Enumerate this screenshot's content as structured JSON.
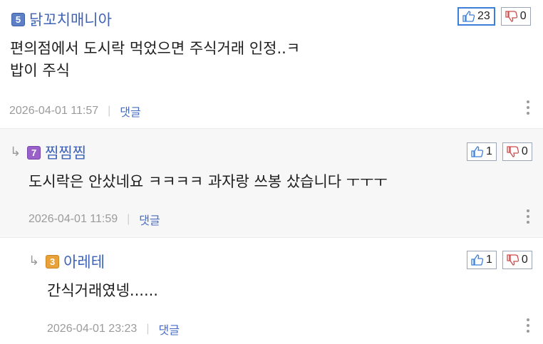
{
  "comments": [
    {
      "level": "5",
      "nickname": "닭꼬치매니아",
      "text": "편의점에서 도시락 먹었으면 주식거래 인정..ㅋ\n밥이 주식",
      "date": "2026-04-01 11:57",
      "reply_label": "댓글",
      "upvotes": "23",
      "downvotes": "0"
    },
    {
      "reply_arrow": "↳",
      "level": "7",
      "nickname": "찜찜찜",
      "text": "도시락은 안샀네요 ㅋㅋㅋㅋ 과자랑 쓰봉 샀습니다 ㅜㅜㅜ",
      "date": "2026-04-01 11:59",
      "reply_label": "댓글",
      "upvotes": "1",
      "downvotes": "0"
    },
    {
      "reply_arrow": "↳",
      "level": "3",
      "nickname": "아레테",
      "text": "간식거래였넹......",
      "date": "2026-04-01 23:23",
      "reply_label": "댓글",
      "upvotes": "1",
      "downvotes": "0"
    }
  ],
  "colors": {
    "nickname": "#3f63b7",
    "reply_link": "#4a6cc0",
    "active_vote_border": "#3d7ed8"
  },
  "icons": {
    "up": "thumbs-up-icon",
    "down": "thumbs-down-icon",
    "more": "more-vertical-icon",
    "reply": "reply-arrow-icon"
  }
}
